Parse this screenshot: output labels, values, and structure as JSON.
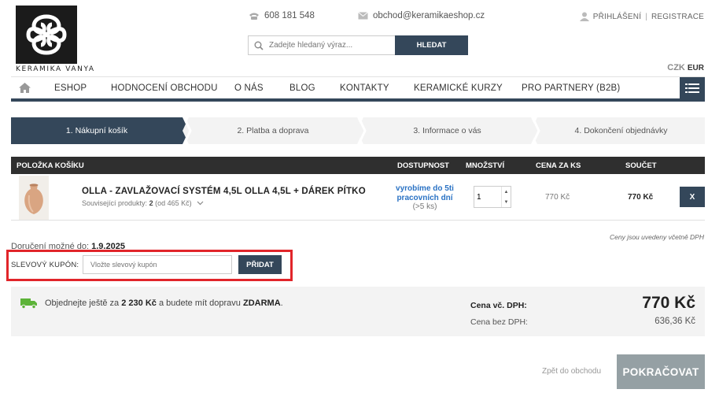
{
  "brand": {
    "logo_text": "KERAMIKA VANYA"
  },
  "header": {
    "phone": "608 181 548",
    "email": "obchod@keramikaeshop.cz",
    "login": "PŘIHLÁŠENÍ",
    "register": "REGISTRACE",
    "search_placeholder": "Zadejte hledaný výraz...",
    "search_button": "HLEDAT",
    "currency_czk": "CZK",
    "currency_eur": "EUR"
  },
  "nav": {
    "items": [
      "ESHOP",
      "HODNOCENÍ OBCHODU",
      "O NÁS",
      "BLOG",
      "KONTAKTY",
      "KERAMICKÉ KURZY",
      "PRO PARTNERY (B2B)"
    ]
  },
  "steps": [
    {
      "label": "1. Nákupní košík",
      "active": true
    },
    {
      "label": "2. Platba a doprava",
      "active": false
    },
    {
      "label": "3. Informace o vás",
      "active": false
    },
    {
      "label": "4. Dokončení objednávky",
      "active": false
    }
  ],
  "table": {
    "headers": [
      "POLOŽKA KOŠÍKU",
      "DOSTUPNOST",
      "MNOŽSTVÍ",
      "CENA ZA KS",
      "SOUČET"
    ],
    "item": {
      "name": "OLLA - ZAVLAŽOVACÍ SYSTÉM 4,5L OLLA 4,5L + DÁREK PÍTKO",
      "related_prefix": "Související produkty:",
      "related_count": "2",
      "related_suffix": "(od 465 Kč)",
      "availability_line1": "vyrobíme do 5ti",
      "availability_line2": "pracovních dní",
      "availability_stock": "(>5 ks)",
      "quantity": "1",
      "unit_price": "770 Kč",
      "total": "770 Kč",
      "remove_label": "X"
    }
  },
  "notes": {
    "vat_note": "Ceny jsou uvedeny včetně DPH",
    "delivery_prefix": "Doručení možné do:",
    "delivery_date": "1.9.2025"
  },
  "coupon": {
    "label": "SLEVOVÝ KUPÓN:",
    "placeholder": "Vložte slevový kupón",
    "button": "PŘIDAT"
  },
  "summary": {
    "ship_prefix": "Objednejte ještě za",
    "ship_amount": "2 230 Kč",
    "ship_middle": "a budete mít dopravu",
    "ship_free": "ZDARMA",
    "ship_end": ".",
    "price_vat_label": "Cena vč. DPH:",
    "price_vat_value": "770 Kč",
    "price_novat_label": "Cena bez DPH:",
    "price_novat_value": "636,36 Kč"
  },
  "footer": {
    "back_link": "Zpět do obchodu",
    "continue_button": "POKRAČOVAT"
  },
  "colors": {
    "primary": "#34475a",
    "highlight": "#e1252a",
    "availability": "#2a72c4",
    "continue": "#95a0a4"
  }
}
